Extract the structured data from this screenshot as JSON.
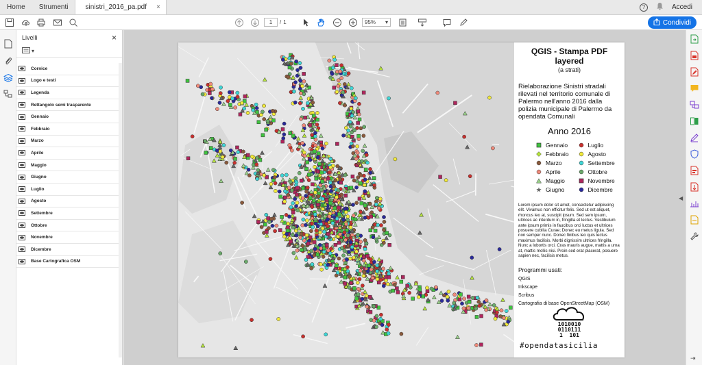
{
  "tabs": {
    "home": "Home",
    "tools": "Strumenti",
    "file": "sinistri_2016_pa.pdf",
    "close": "×"
  },
  "account": {
    "help": "?",
    "signin": "Accedi"
  },
  "toolbar": {
    "page_current": "1",
    "page_sep": "/",
    "page_total": "1",
    "zoom": "95%",
    "share_label": "Condividi"
  },
  "layers_panel": {
    "title": "Livelli",
    "close": "×",
    "items": [
      "Cornice",
      "Logo e testi",
      "Legenda",
      "Rettangolo semi trasparente",
      "Gennaio",
      "Febbraio",
      "Marzo",
      "Aprile",
      "Maggio",
      "Giugno",
      "Luglio",
      "Agosto",
      "Settembre",
      "Ottobre",
      "Novembre",
      "Dicembre",
      "Base Cartografica OSM"
    ]
  },
  "document": {
    "title": "QGIS - Stampa PDF layered",
    "subtitle": "(a strati)",
    "description": "Rielaborazione Sinistri stradali rilevati nel territorio comunale di Palermo nell'anno 2016 dalla polizia municipale di Palermo da opendata Comunali",
    "year": "Anno 2016",
    "legend": [
      {
        "label": "Gennaio",
        "shape": "square",
        "color": "#3fc33f"
      },
      {
        "label": "Luglio",
        "shape": "circle",
        "color": "#c8312e"
      },
      {
        "label": "Febbraio",
        "shape": "diamond",
        "color": "#b5e33c"
      },
      {
        "label": "Agosto",
        "shape": "circle",
        "color": "#f2ea3a"
      },
      {
        "label": "Marzo",
        "shape": "circle",
        "color": "#8b5a3c"
      },
      {
        "label": "Settembre",
        "shape": "circle",
        "color": "#3fd6d6"
      },
      {
        "label": "Aprile",
        "shape": "circle",
        "color": "#f08a7a"
      },
      {
        "label": "Ottobre",
        "shape": "circle",
        "color": "#6aa96a"
      },
      {
        "label": "Maggio",
        "shape": "triangle",
        "color": "#9ad08a"
      },
      {
        "label": "Novembre",
        "shape": "square",
        "color": "#b0265d"
      },
      {
        "label": "Giugno",
        "shape": "star",
        "color": "#666666"
      },
      {
        "label": "Dicembre",
        "shape": "circle",
        "color": "#2a2a9a"
      }
    ],
    "lorem": "Lorem ipsum dolor sit amet, consectetur adipiscing elit. Vivamus non efficitur felis. Sed ut est aliquet, rhoncus leo at, suscipit ipsum. Sed sem ipsum, ultrices ac interdum in, fringilla et lectus. Vestibulum ante ipsum primis in faucibus orci luctus et ultrices posuere cubilia Curae; Donec eu metus ligula. Sed non semper nunc. Donec finibus leo quis lectus maximus facilisis. Morbi dignissim ultrices fringilla. Nunc a lobortis orci. Cras mauris augue, mattis a urna at, mattis mollis nisi. Proin sed erat placerat, posuere sapien nec, facilisis metus.",
    "programs_title": "Programmi usati:",
    "programs": [
      "QGIS",
      "Inkscape",
      "Scribus",
      "Cartografia di base OpenStreetMap (OSM)"
    ],
    "binary_lines": [
      "1010010",
      "0110111",
      "1  101"
    ],
    "hashtag": "#opendatasicilia"
  },
  "colors": {
    "accent": "#1473e6",
    "map_bg": "#cfcfcf",
    "map_land": "#e4e4e4",
    "sea": "#dcdcdc"
  }
}
